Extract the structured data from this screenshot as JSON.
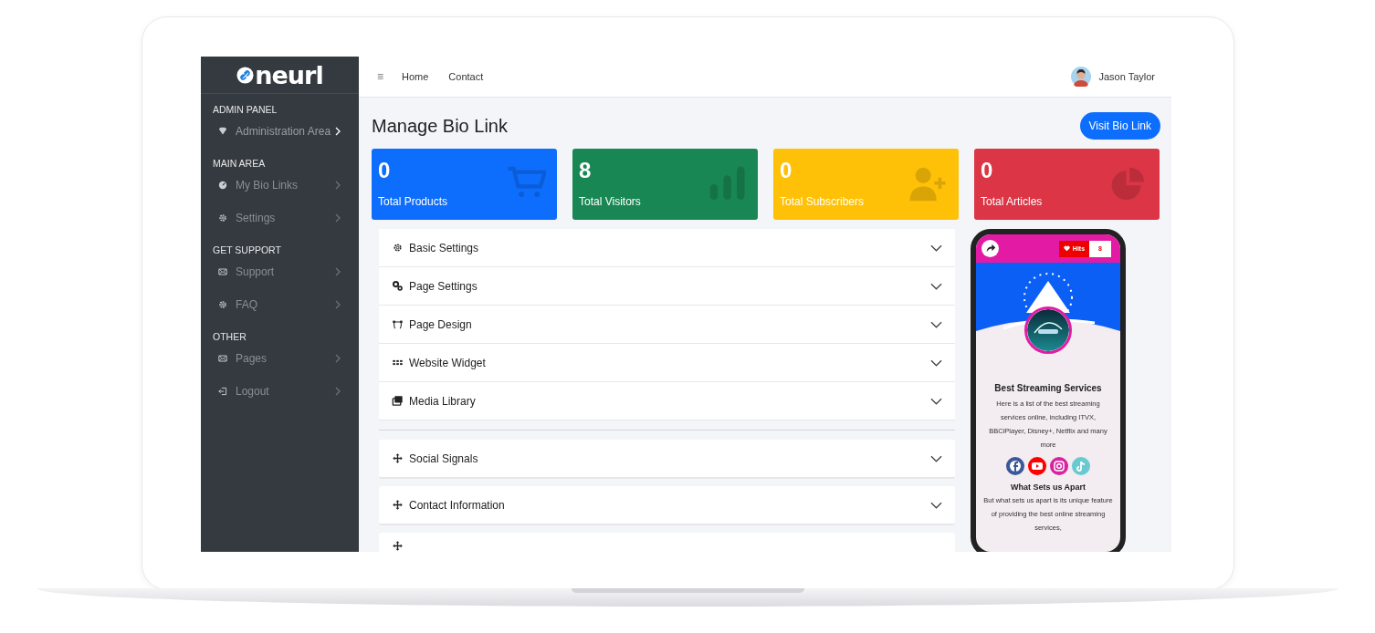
{
  "brand": {
    "logo": "neurl"
  },
  "sidebar": {
    "sections": [
      {
        "heading": "ADMIN PANEL",
        "items": [
          {
            "label": "Administration Area",
            "kind": "gem",
            "selected": true
          }
        ]
      },
      {
        "heading": "MAIN AREA",
        "items": [
          {
            "label": "My Bio Links",
            "kind": "gauge",
            "selected": false
          },
          {
            "label": "Settings",
            "kind": "gear",
            "selected": false
          }
        ]
      },
      {
        "heading": "GET SUPPORT",
        "items": [
          {
            "label": "Support",
            "kind": "mail",
            "selected": false
          },
          {
            "label": "FAQ",
            "kind": "gear",
            "selected": false
          }
        ]
      },
      {
        "heading": "OTHER",
        "items": [
          {
            "label": "Pages",
            "kind": "mail",
            "selected": false
          },
          {
            "label": "Logout",
            "kind": "logout",
            "selected": false
          }
        ]
      }
    ]
  },
  "topbar": {
    "menu_icon": "≡",
    "links": [
      "Home",
      "Contact"
    ],
    "user": "Jason Taylor"
  },
  "page": {
    "title": "Manage Bio Link",
    "action": "Visit Bio Link"
  },
  "stats": [
    {
      "value": "0",
      "label": "Total Products",
      "color": "#0d6efd",
      "kind": "cart"
    },
    {
      "value": "8",
      "label": "Total Visitors",
      "color": "#198754",
      "kind": "bars"
    },
    {
      "value": "0",
      "label": "Total Subscribers",
      "color": "#ffc107",
      "kind": "user-plus"
    },
    {
      "value": "0",
      "label": "Total Articles",
      "color": "#dc3545",
      "kind": "pie"
    }
  ],
  "settings_group": [
    {
      "label": "Basic Settings",
      "kind": "gear"
    },
    {
      "label": "Page Settings",
      "kind": "gears"
    },
    {
      "label": "Page Design",
      "kind": "bezier"
    },
    {
      "label": "Website Widget",
      "kind": "grid"
    },
    {
      "label": "Media Library",
      "kind": "images"
    }
  ],
  "blocks": [
    {
      "label": "Social Signals",
      "kind": "move"
    },
    {
      "label": "Contact Information",
      "kind": "move"
    },
    {
      "kind": "move"
    }
  ],
  "preview": {
    "hits_label": "Hits",
    "hits": "8",
    "title": "Best Streaming Services",
    "description": "Here is a list of the best streaming services online, including ITVX, BBCiPlayer, Disney+, Netflix and many more",
    "socials": [
      {
        "kind": "facebook",
        "color": "#3b5998"
      },
      {
        "kind": "youtube",
        "color": "#ff0000"
      },
      {
        "kind": "instagram",
        "color": "#d6249f"
      },
      {
        "kind": "tiktok",
        "color": "#69c9d0"
      }
    ],
    "subtitle": "What Sets us Apart",
    "body": "But what sets us apart is its unique feature of providing the best online streaming services,"
  }
}
